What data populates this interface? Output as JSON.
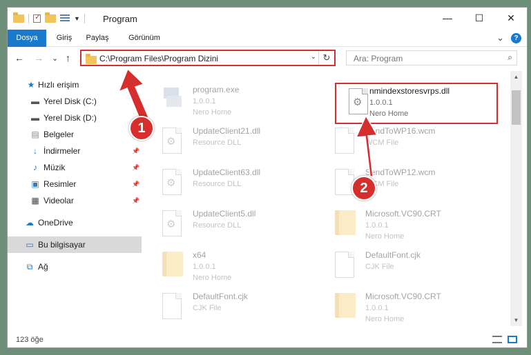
{
  "window": {
    "title": "Program",
    "minimize": "—",
    "maximize": "☐",
    "close": "✕"
  },
  "ribbon": {
    "tabs": [
      "Dosya",
      "Giriş",
      "Paylaş",
      "Görünüm"
    ],
    "expand": "⌄",
    "help": "?"
  },
  "nav": {
    "back": "←",
    "forward": "→",
    "recent": "⌄",
    "up": "↑",
    "address": "C:\\Program Files\\Program Dizini",
    "search_placeholder": "Ara: Program"
  },
  "sidebar": {
    "items": [
      {
        "label": "Hızlı erişim",
        "icon": "star-icon"
      },
      {
        "label": "Yerel Disk (C:)",
        "icon": "drive-icon"
      },
      {
        "label": "Yerel Disk (D:)",
        "icon": "drive-icon"
      },
      {
        "label": "Belgeler",
        "icon": "documents-icon"
      },
      {
        "label": "İndirmeler",
        "icon": "download-icon"
      },
      {
        "label": "Müzik",
        "icon": "music-icon"
      },
      {
        "label": "Resimler",
        "icon": "pictures-icon"
      },
      {
        "label": "Videolar",
        "icon": "video-icon"
      },
      {
        "label": "OneDrive",
        "icon": "cloud-icon"
      },
      {
        "label": "Bu bilgisayar",
        "icon": "computer-icon"
      },
      {
        "label": "Ağ",
        "icon": "network-icon"
      }
    ]
  },
  "files": [
    {
      "name": "program.exe",
      "l2": "1.0.0.1",
      "l3": "Nero Home",
      "icon": "exe"
    },
    {
      "name": "nmindexstoresvrps.dll",
      "l2": "1.0.0.1",
      "l3": "Nero Home",
      "icon": "dll"
    },
    {
      "name": "UpdateClient21.dll",
      "l2": "Resource DLL",
      "l3": "",
      "icon": "dll"
    },
    {
      "name": "SendToWP16.wcm",
      "l2": "WCM File",
      "l3": "",
      "icon": "doc"
    },
    {
      "name": "UpdateClient63.dll",
      "l2": "Resource DLL",
      "l3": "",
      "icon": "dll"
    },
    {
      "name": "SendToWP12.wcm",
      "l2": "WCM File",
      "l3": "",
      "icon": "doc"
    },
    {
      "name": "UpdateClient5.dll",
      "l2": "Resource DLL",
      "l3": "",
      "icon": "dll"
    },
    {
      "name": "Microsoft.VC90.CRT",
      "l2": "1.0.0.1",
      "l3": "Nero Home",
      "icon": "folder"
    },
    {
      "name": "x64",
      "l2": "1.0.0.1",
      "l3": "Nero Home",
      "icon": "folder"
    },
    {
      "name": "DefaultFont.cjk",
      "l2": "CJK File",
      "l3": "",
      "icon": "doc"
    },
    {
      "name": "DefaultFont.cjk",
      "l2": "CJK File",
      "l3": "",
      "icon": "doc"
    },
    {
      "name": "Microsoft.VC90.CRT",
      "l2": "1.0.0.1",
      "l3": "Nero Home",
      "icon": "folder"
    }
  ],
  "status": {
    "count": "123 öğe"
  },
  "annotations": {
    "badge1": "1",
    "badge2": "2",
    "color": "#d62d2d"
  }
}
